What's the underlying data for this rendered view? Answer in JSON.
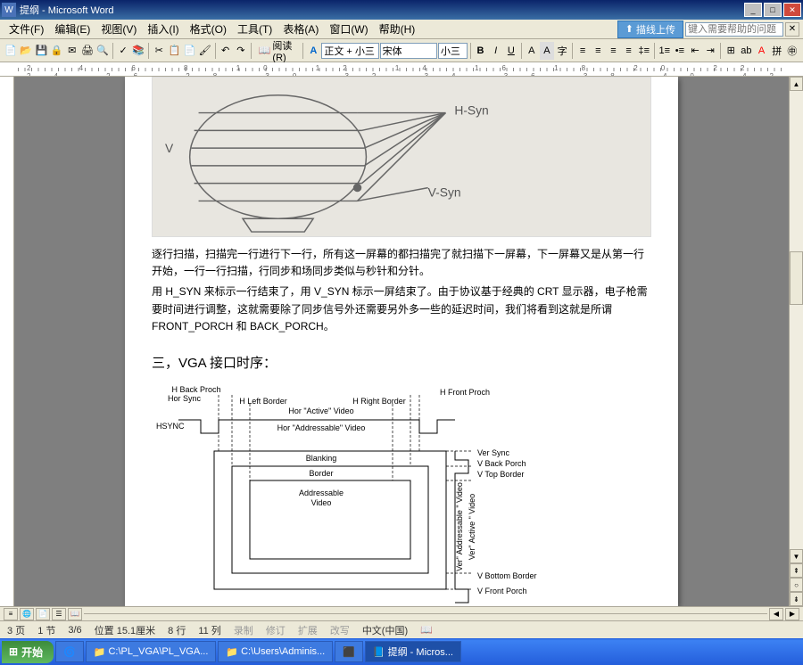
{
  "titlebar": {
    "title": "提纲 - Microsoft Word"
  },
  "menus": [
    "文件(F)",
    "编辑(E)",
    "视图(V)",
    "插入(I)",
    "格式(O)",
    "工具(T)",
    "表格(A)",
    "窗口(W)",
    "帮助(H)"
  ],
  "help_placeholder": "键入需要帮助的问题",
  "upload_label": "描线上传",
  "toolbar": {
    "read_label": "阅读(R)",
    "style": "正文 + 小三",
    "font": "宋体",
    "size": "小三"
  },
  "doc": {
    "para1": "逐行扫描，扫描完一行进行下一行，所有这一屏幕的都扫描完了就扫描下一屏幕，下一屏幕又是从第一行开始，一行一行扫描，行同步和场同步类似与秒针和分针。",
    "para2": "用 H_SYN 来标示一行结束了，用 V_SYN 标示一屏结束了。由于协议基于经典的 CRT 显示器，电子枪需要时间进行调整，这就需要除了同步信号外还需要另外多一些的延迟时间，我们将看到这就是所谓 FRONT_PORCH 和 BACK_PORCH。",
    "heading3": "三，VGA 接口时序：",
    "sketch": {
      "v": "V",
      "hsyn": "H-Syn",
      "vsyn": "V-Syn"
    },
    "timing": {
      "hsync": "HSYNC",
      "hbackporch": "H Back Proch",
      "hfrontporch": "H Front Proch",
      "horsync": "Hor Sync",
      "hleftborder": "H Left Border",
      "hrightborder": "H Right Border",
      "horactive": "Hor \"Active\" Video",
      "horaddressable": "Hor \"Addressable\" Video",
      "blanking": "Blanking",
      "border": "Border",
      "addressable": "Addressable",
      "video": "Video",
      "versync": "Ver Sync",
      "vbackporch": "V Back Porch",
      "vtopborder": "V Top Border",
      "vbottomborder": "V Bottom Border",
      "vfrontporch": "V Front Porch",
      "veractive": "Ver\" Active \" Video",
      "veraddressable": "Ver\" Addressable \" Video"
    }
  },
  "statusbar": {
    "page": "3 页",
    "section": "1 节",
    "pages": "3/6",
    "position": "位置 15.1厘米",
    "line": "8 行",
    "col": "11 列",
    "rec": "录制",
    "trk": "修订",
    "ext": "扩展",
    "ovr": "改写",
    "lang": "中文(中国)"
  },
  "taskbar": {
    "start": "开始",
    "items": [
      "",
      "C:\\PL_VGA\\PL_VGA...",
      "C:\\Users\\Adminis...",
      "",
      "提纲 - Micros..."
    ]
  }
}
